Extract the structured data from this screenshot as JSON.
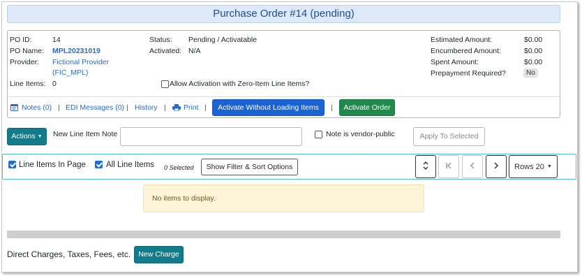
{
  "header": {
    "title": "Purchase Order #14 (pending)"
  },
  "summary": {
    "po_id_label": "PO ID:",
    "po_id_value": "14",
    "po_name_label": "PO Name:",
    "po_name_value": "MPL20231019",
    "provider_label": "Provider:",
    "provider_line1": "Fictional Provider",
    "provider_line2": "(FIC_MPL)",
    "line_items_label": "Line Items:",
    "line_items_value": "0",
    "status_label": "Status:",
    "status_value": "Pending / Activatable",
    "activated_label": "Activated:",
    "activated_value": "N/A",
    "zero_item_label": "Allow Activation with Zero-Item Line Items?",
    "estimated_label": "Estimated Amount:",
    "estimated_value": "$0.00",
    "encumbered_label": "Encumbered Amount:",
    "encumbered_value": "$0.00",
    "spent_label": "Spent Amount:",
    "spent_value": "$0.00",
    "prepayment_label": "Prepayment Required?",
    "prepayment_value": "No"
  },
  "actions_bar": {
    "notes": "Notes (0)",
    "edi": "EDI Messages (0)",
    "history": "History",
    "print": "Print",
    "activate_without_loading": "Activate Without Loading Items",
    "activate_order": "Activate Order",
    "separator": "|"
  },
  "line_item_controls": {
    "actions_label": "Actions",
    "note_label": "New Line Item Note",
    "note_value": "",
    "vendor_public_label": "Note is vendor-public",
    "apply_label": "Apply To Selected"
  },
  "grid_toolbar": {
    "line_items_in_page": "Line Items In Page",
    "all_line_items": "All Line Items",
    "selected_count": "0 Selected",
    "filter_sort": "Show Filter & Sort Options",
    "rows_label": "Rows 20"
  },
  "grid": {
    "empty_message": "No items to display."
  },
  "charges": {
    "label": "Direct Charges, Taxes, Fees, etc.",
    "new_charge": "New Charge"
  },
  "colors": {
    "primary": "#1b63d2",
    "success": "#1f8a4c",
    "teal": "#137c8b",
    "link": "#2a6ac4",
    "warning_bg": "#fdf3d5"
  }
}
